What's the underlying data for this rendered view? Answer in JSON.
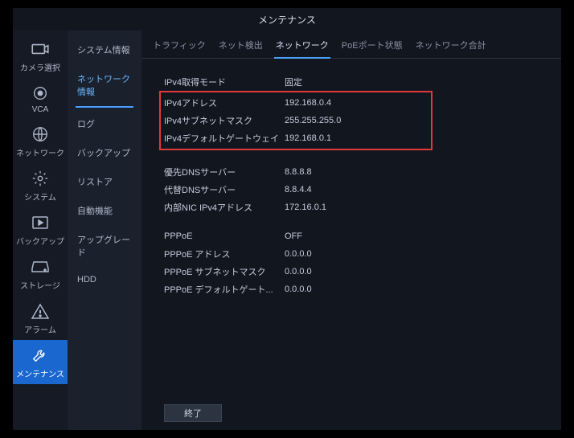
{
  "title": "メンテナンス",
  "sidebar": [
    {
      "key": "camera",
      "label": "カメラ選択"
    },
    {
      "key": "vca",
      "label": "VCA"
    },
    {
      "key": "network",
      "label": "ネットワーク"
    },
    {
      "key": "system",
      "label": "システム"
    },
    {
      "key": "backup",
      "label": "バックアップ"
    },
    {
      "key": "storage",
      "label": "ストレージ"
    },
    {
      "key": "alarm",
      "label": "アラーム"
    },
    {
      "key": "maint",
      "label": "メンテナンス",
      "active": true
    }
  ],
  "subnav": [
    {
      "label": "システム情報"
    },
    {
      "label": "ネットワーク情報",
      "active": true
    },
    {
      "label": "ログ"
    },
    {
      "label": "バックアップ"
    },
    {
      "label": "リストア"
    },
    {
      "label": "自動機能"
    },
    {
      "label": "アップグレード"
    },
    {
      "label": "HDD"
    }
  ],
  "tabs": [
    {
      "label": "トラフィック"
    },
    {
      "label": "ネット検出"
    },
    {
      "label": "ネットワーク",
      "active": true
    },
    {
      "label": "PoEポート状態"
    },
    {
      "label": "ネットワーク合計"
    }
  ],
  "rows": {
    "mode": {
      "label": "IPv4取得モード",
      "value": "固定"
    },
    "ip": {
      "label": "IPv4アドレス",
      "value": "192.168.0.4"
    },
    "mask": {
      "label": "IPv4サブネットマスク",
      "value": "255.255.255.0"
    },
    "gw": {
      "label": "IPv4デフォルトゲートウェイ",
      "value": "192.168.0.1"
    },
    "dns1": {
      "label": "優先DNSサーバー",
      "value": "8.8.8.8"
    },
    "dns2": {
      "label": "代替DNSサーバー",
      "value": "8.8.4.4"
    },
    "nicip": {
      "label": "内部NIC IPv4アドレス",
      "value": "172.16.0.1"
    },
    "pppoe": {
      "label": "PPPoE",
      "value": "OFF"
    },
    "pppoe_addr": {
      "label": "PPPoE アドレス",
      "value": "0.0.0.0"
    },
    "pppoe_mask": {
      "label": "PPPoE サブネットマスク",
      "value": "0.0.0.0"
    },
    "pppoe_gw": {
      "label": "PPPoE デフォルトゲート...",
      "value": "0.0.0.0"
    }
  },
  "buttons": {
    "exit": "終了"
  },
  "colors": {
    "accent": "#4aa0ff",
    "highlight": "#e03a3a"
  }
}
